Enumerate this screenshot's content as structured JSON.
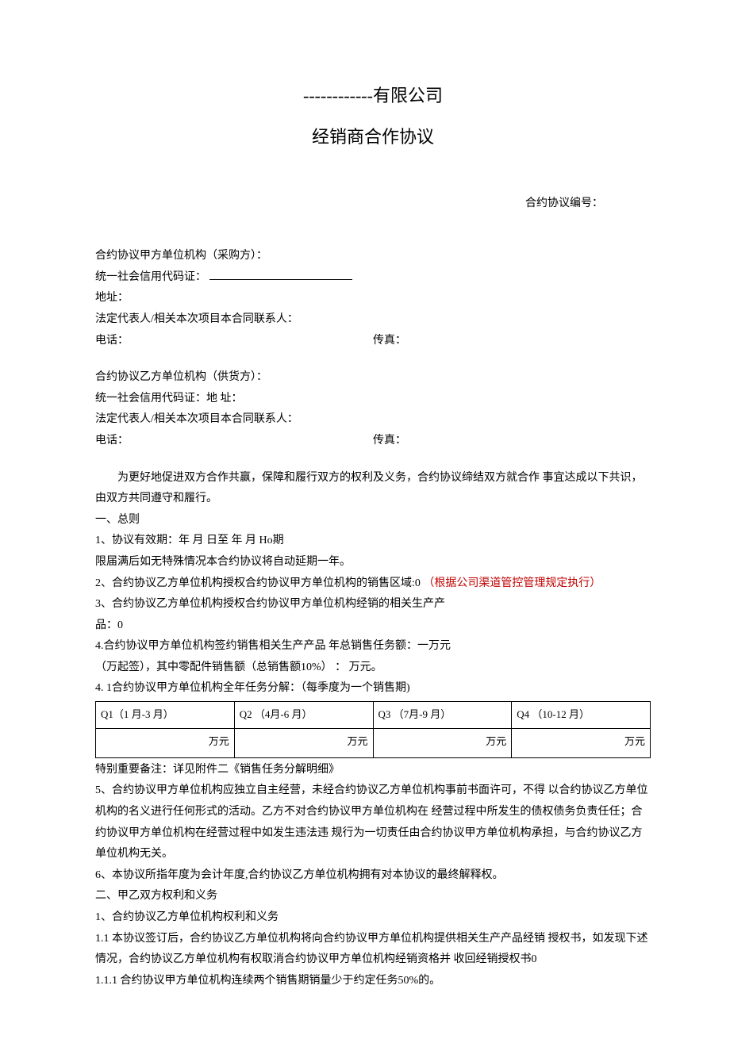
{
  "header": {
    "company_line": "------------有限公司",
    "doc_title": "经销商合作协议",
    "contract_no_label": "合约协议编号："
  },
  "partyA": {
    "line1": "合约协议甲方单位机构（采购方）：",
    "credit_label": "统一社会信用代码证：",
    "addr_label": "地址：",
    "rep_label": "法定代表人/相关本次项目本合同联系人：",
    "phone_label": "电话：",
    "fax_label": "传真："
  },
  "partyB": {
    "line1": "合约协议乙方单位机构（供货方）：",
    "credit_addr": "统一社会信用代码证：地 址：",
    "rep_label": "法定代表人/相关本次项目本合同联系人：",
    "phone_label": "电话：",
    "fax_label": "传真："
  },
  "body": {
    "preamble": "为更好地促进双方合作共赢，保障和履行双方的权利及义务，合约协议缔结双方就合作 事宜达成以下共识，由双方共同遵守和履行。",
    "sec1_head": "一、总则",
    "c1": "1、协议有效期：年 月 日至 年 月 Ho期",
    "c1b": "限届满后如无特殊情况本合约协议将自动延期一年。",
    "c2a": "2、合约协议乙方单位机构授权合约协议甲方单位机构的销售区域:0 ",
    "c2b": "（根据公司渠道管控管理规定执行）",
    "c3": "3、合约协议乙方单位机构授权合约协议甲方单位机构经销的相关生产产",
    "c3b": "品：0",
    "c4": "4.合约协议甲方单位机构签约销售相关生产产品 年总销售任务额：一万元",
    "c4b": "（万起签），其中零配件销售额（总销售额10%） ： 万元。",
    "c41": "4. 1合约协议甲方单位机构全年任务分解：（每季度为一个销售期)",
    "table": {
      "q1": "Q1（1 月-3 月）",
      "q2": "Q2 （4月-6 月）",
      "q3": "Q3 （7月-9 月）",
      "q4": "Q4 （10-12 月）",
      "unit": "万元"
    },
    "note": "特别重要备注：详见附件二《销售任务分解明细》",
    "c5": "5、合约协议甲方单位机构应独立自主经营，未经合约协议乙方单位机构事前书面许可，不得 以合约协议乙方单位机构的名义进行任何形式的活动。乙方不对合约协议甲方单位机构在 经营过程中所发生的债权债务负责任任；合约协议甲方单位机构在经营过程中如发生违法违 规行为一切责任由合约协议甲方单位机构承担，与合约协议乙方单位机构无关。",
    "c6": "6、本协议所指年度为会计年度,合约协议乙方单位机构拥有对本协议的最终解释权。",
    "sec2_head": "二、甲乙双方权利和义务",
    "s21": "1、合约协议乙方单位机构权利和义务",
    "s211": "1.1  本协议签订后，合约协议乙方单位机构将向合约协议甲方单位机构提供相关生产产品经销 授权书，如发现下述情况，合约协议乙方单位机构有权取消合约协议甲方单位机构经销资格并 收回经销授权书0",
    "s2111": "1.1.1  合约协议甲方单位机构连续两个销售期销量少于约定任务50%的。"
  }
}
